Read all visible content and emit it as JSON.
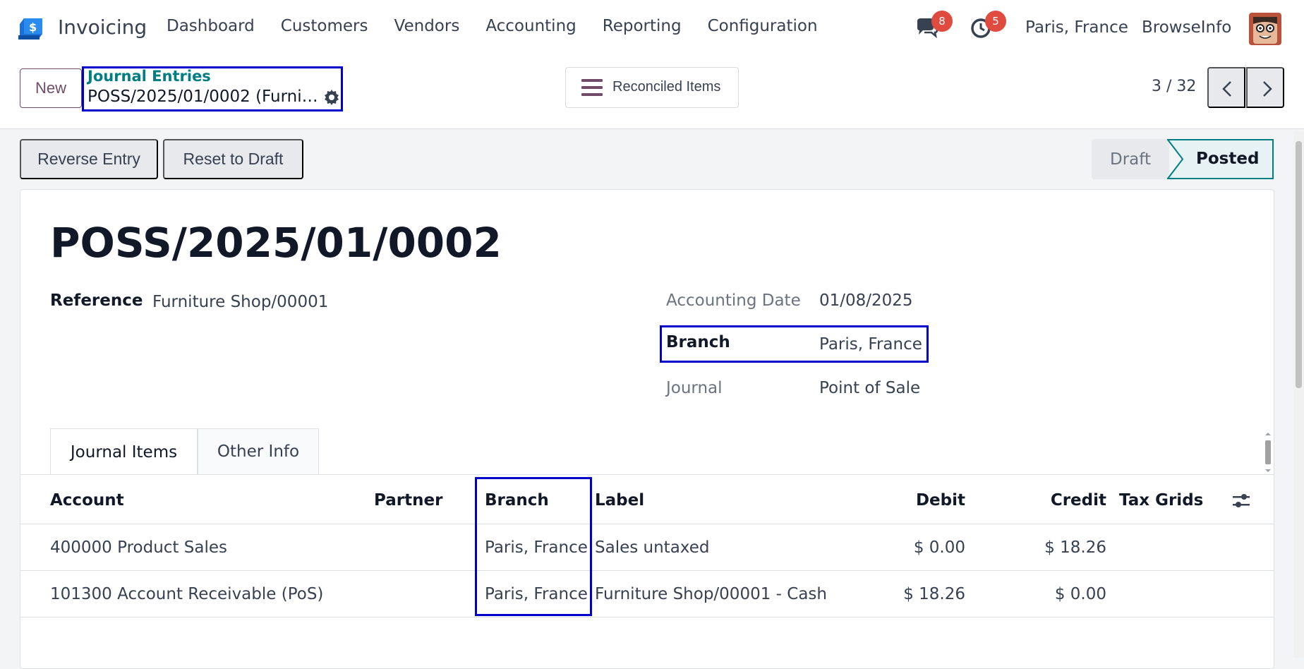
{
  "navbar": {
    "app_name": "Invoicing",
    "menu": [
      "Dashboard",
      "Customers",
      "Vendors",
      "Accounting",
      "Reporting",
      "Configuration"
    ],
    "chat_count": "8",
    "activity_count": "5",
    "company": "Paris, France",
    "database": "BrowseInfo"
  },
  "control": {
    "new_label": "New",
    "breadcrumb_parent": "Journal Entries",
    "breadcrumb_current": "POSS/2025/01/0002 (Furniture Shop/00001)",
    "reconciled_label": "Reconciled Items",
    "pager": "3 / 32"
  },
  "statusbar": {
    "reverse_label": "Reverse Entry",
    "reset_label": "Reset to Draft",
    "stages": [
      "Draft",
      "Posted"
    ],
    "current_stage": "Posted"
  },
  "form": {
    "name": "POSS/2025/01/0002",
    "reference_label": "Reference",
    "reference_value": "Furniture Shop/00001",
    "date_label": "Accounting Date",
    "date_value": "01/08/2025",
    "branch_label": "Branch",
    "branch_value": "Paris, France",
    "journal_label": "Journal",
    "journal_value": "Point of Sale"
  },
  "tabs": [
    "Journal Items",
    "Other Info"
  ],
  "table": {
    "headers": [
      "Account",
      "Partner",
      "Branch",
      "Label",
      "Debit",
      "Credit",
      "Tax Grids"
    ],
    "rows": [
      {
        "account": "400000 Product Sales",
        "partner": "",
        "branch": "Paris, France",
        "label": "Sales untaxed",
        "debit": "$ 0.00",
        "credit": "$ 18.26",
        "tax": ""
      },
      {
        "account": "101300 Account Receivable (PoS)",
        "partner": "",
        "branch": "Paris, France",
        "label": "Furniture Shop/00001 - Cash",
        "debit": "$ 18.26",
        "credit": "$ 0.00",
        "tax": ""
      }
    ]
  },
  "colors": {
    "brand": "#714b67",
    "link": "#017e84",
    "highlight_box": "#0000cc",
    "badge": "#e04b3f"
  }
}
